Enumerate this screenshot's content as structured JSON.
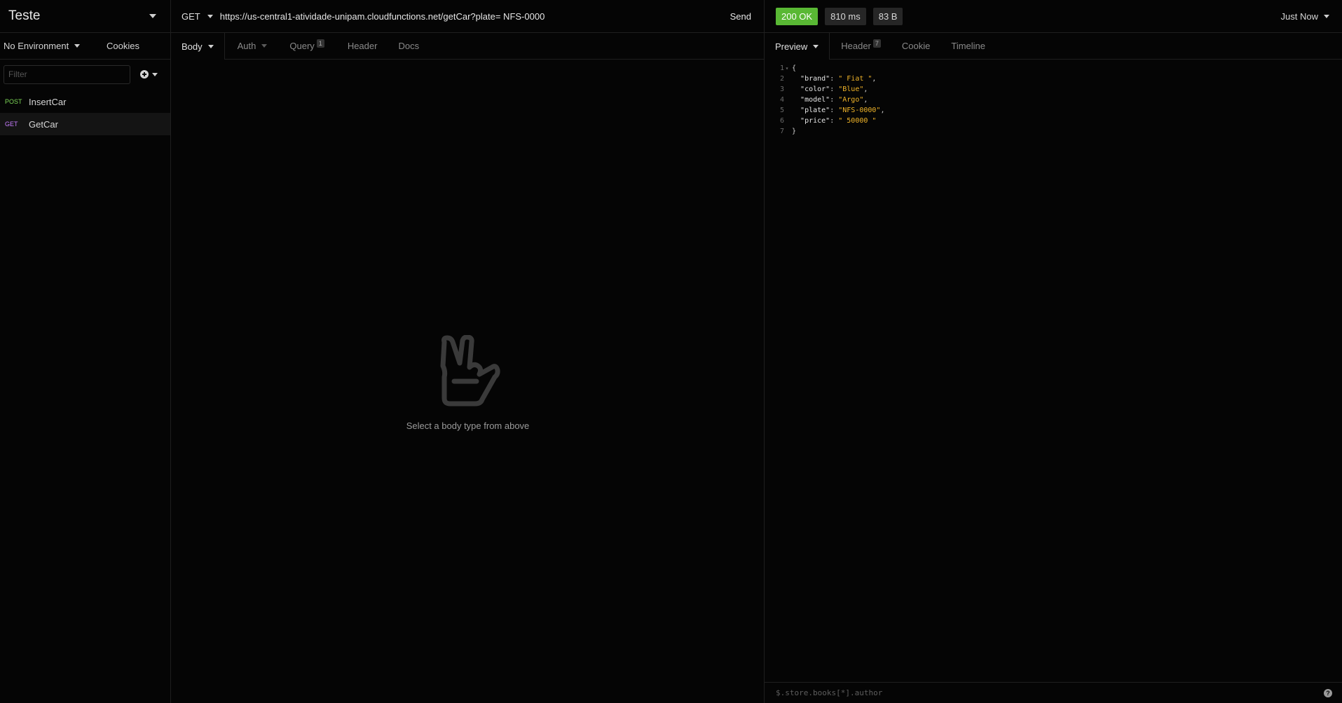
{
  "sidebar": {
    "workspace_title": "Teste",
    "environment_label": "No Environment",
    "cookies_label": "Cookies",
    "filter_placeholder": "Filter",
    "requests": [
      {
        "method": "POST",
        "name": "InsertCar",
        "active": false
      },
      {
        "method": "GET",
        "name": "GetCar",
        "active": true
      }
    ]
  },
  "request": {
    "method": "GET",
    "url": "https://us-central1-atividade-unipam.cloudfunctions.net/getCar?plate= NFS-0000",
    "send_label": "Send",
    "tabs": {
      "body": "Body",
      "auth": "Auth",
      "query": "Query",
      "query_count": "1",
      "header": "Header",
      "docs": "Docs"
    },
    "empty_message": "Select a body type from above"
  },
  "response": {
    "status": "200 OK",
    "time": "810 ms",
    "size": "83 B",
    "history_label": "Just Now",
    "tabs": {
      "preview": "Preview",
      "header": "Header",
      "header_count": "7",
      "cookie": "Cookie",
      "timeline": "Timeline"
    },
    "body_lines": [
      {
        "num": "1",
        "key": "",
        "value": "",
        "text": "{"
      },
      {
        "num": "2",
        "key": "\"brand\"",
        "value": "\" Fiat \""
      },
      {
        "num": "3",
        "key": "\"color\"",
        "value": "\"Blue\""
      },
      {
        "num": "4",
        "key": "\"model\"",
        "value": "\"Argo\""
      },
      {
        "num": "5",
        "key": "\"plate\"",
        "value": "\"NFS-0000\""
      },
      {
        "num": "6",
        "key": "\"price\"",
        "value": "\" 50000 \""
      },
      {
        "num": "7",
        "key": "",
        "value": "",
        "text": "}"
      }
    ],
    "filter_placeholder": "$.store.books[*].author"
  },
  "colors": {
    "status_ok": "#59b834",
    "post_method": "#7ed957",
    "get_method": "#c77dff",
    "json_string": "#f0b429"
  },
  "icons": [
    "chevron-down-icon",
    "plus-circle-icon",
    "peace-hand-icon",
    "help-icon"
  ]
}
